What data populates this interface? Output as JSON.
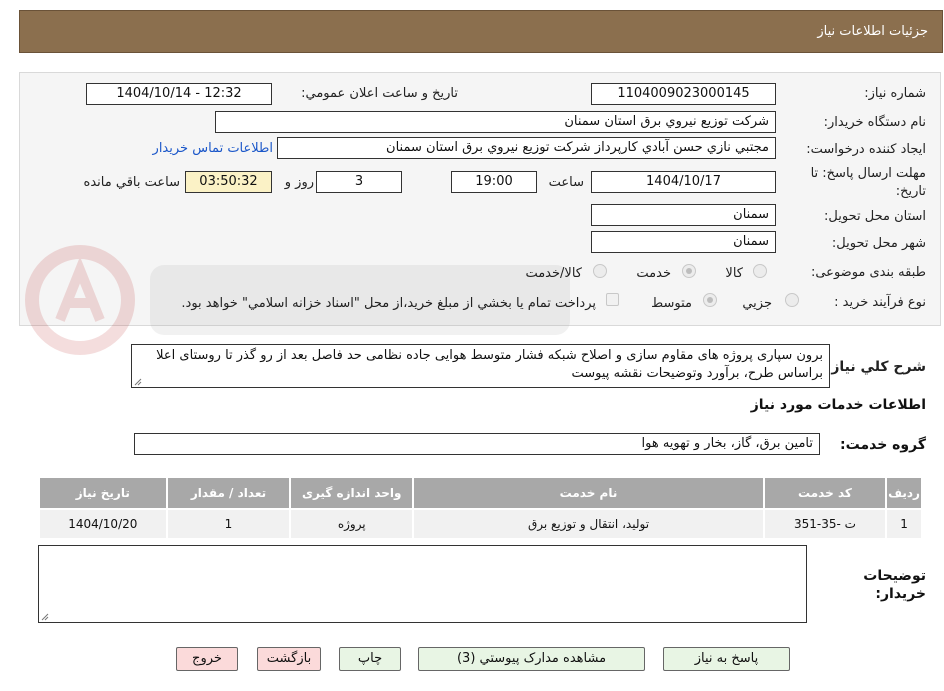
{
  "header": {
    "title": "جزئيات اطلاعات نياز"
  },
  "form": {
    "need_number": {
      "label": "شماره نياز:",
      "value": "1104009023000145"
    },
    "announce_datetime": {
      "label": "تاريخ و ساعت اعلان عمومي:",
      "value": "1404/10/14 - 12:32"
    },
    "buyer_org": {
      "label": "نام دستگاه خريدار:",
      "value": "شركت توزيع نيروي برق استان سمنان"
    },
    "requester": {
      "label": "ايجاد كننده درخواست:",
      "value": "مجتبي نازي حسن آبادي كارپرداز شركت توزيع نيروي برق استان سمنان",
      "contact_link": "اطلاعات تماس خريدار"
    },
    "deadline": {
      "label_line1": "مهلت ارسال پاسخ: تا",
      "label_line2": "تاريخ:",
      "date": "1404/10/17",
      "time_label": "ساعت",
      "time": "19:00",
      "days": "3",
      "days_label": "روز و",
      "remaining": "03:50:32",
      "remaining_label": "ساعت باقي مانده"
    },
    "province": {
      "label": "استان محل تحويل:",
      "value": "سمنان"
    },
    "city": {
      "label": "شهر محل تحويل:",
      "value": "سمنان"
    },
    "category": {
      "label": "طبقه بندی موضوعی:",
      "options": [
        "كالا",
        "خدمت",
        "كالا/خدمت"
      ],
      "selected": "خدمت"
    },
    "process": {
      "label": "نوع فرآيند خريد :",
      "options": [
        "جزيي",
        "متوسط"
      ],
      "selected": "متوسط",
      "payment_note": "پرداخت تمام يا بخشي از مبلغ خريد،از محل \"اسناد خزانه اسلامي\" خواهد بود."
    }
  },
  "description": {
    "label": "شرح كلي نياز:",
    "value": "برون سپاری پروژه های مقاوم سازی و اصلاح شبکه فشار متوسط هوایی جاده نظامی حد فاصل بعد از رو گذر تا روستای اعلا براساس طرح، برآورد وتوضیحات نقشه پیوست"
  },
  "services": {
    "section_title": "اطلاعات خدمات مورد نياز",
    "group_label": "گروه خدمت:",
    "group_value": "تامين برق، گاز، بخار و تهويه هوا",
    "columns": [
      "رديف",
      "كد خدمت",
      "نام خدمت",
      "واحد اندازه گيری",
      "تعداد / مقدار",
      "تاريخ نياز"
    ],
    "rows": [
      {
        "index": "1",
        "code": "ت -35-351",
        "name": "توليد، انتقال و توزيع برق",
        "unit": "پروژه",
        "qty": "1",
        "date": "1404/10/20"
      }
    ]
  },
  "buyer_notes": {
    "label_line1": "توضيحات",
    "label_line2": "خريدار:",
    "value": ""
  },
  "buttons": {
    "reply": "پاسخ به نياز",
    "documents": "مشاهده مدارک پيوستي (3)",
    "print": "چاپ",
    "back": "بازگشت",
    "exit": "خروج"
  },
  "colors": {
    "header_bg": "#8b6f4e",
    "link": "#1b57c9",
    "remaining_bg": "#fbf2c6",
    "table_header_bg": "#a8a8a8",
    "button_green": "#e8f5e4",
    "button_pink": "#fbdada"
  }
}
